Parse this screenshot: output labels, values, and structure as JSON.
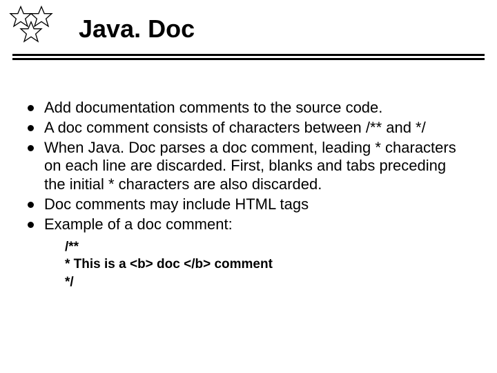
{
  "title": "Java. Doc",
  "bullets": [
    "Add documentation comments to the source code.",
    "A doc comment consists of characters between /**   and */",
    "When Java. Doc parses a doc comment, leading * characters on each line are discarded. First, blanks and tabs preceding the initial * characters are also discarded.",
    "Doc comments may include HTML tags",
    "Example of a doc comment:"
  ],
  "code": {
    "line1": "/**",
    "line2": "* This is a <b> doc </b> comment",
    "line3": "*/"
  }
}
